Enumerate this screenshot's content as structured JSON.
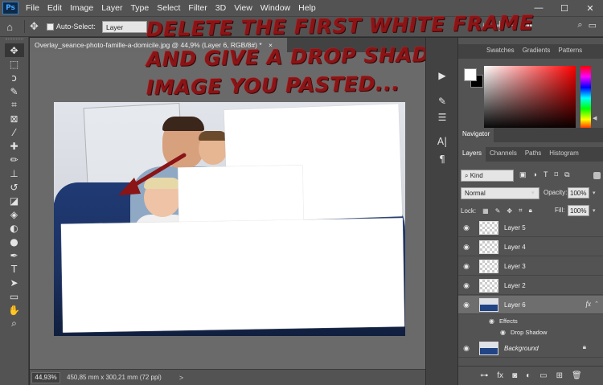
{
  "app": {
    "logo": "Ps"
  },
  "menu": [
    "File",
    "Edit",
    "Image",
    "Layer",
    "Type",
    "Select",
    "Filter",
    "3D",
    "View",
    "Window",
    "Help"
  ],
  "window_controls": {
    "minimize": "—",
    "maximize": "☐",
    "close": "✕"
  },
  "options_bar": {
    "auto_select_label": "Auto-Select:",
    "auto_select_value": "Layer",
    "more": "•••"
  },
  "document": {
    "tab_title": "Overlay_seance-photo-famille-a-domicile.jpg @ 44,9% (Layer 6, RGB/8#) *",
    "tab_close": "×"
  },
  "status": {
    "zoom": "44,93%",
    "doc_size": "450,85 mm x 300,21 mm (72 ppi)",
    "arrow": ">"
  },
  "instruction": {
    "line1": "DELETE THE FIRST WHITE FRAME",
    "line2": "AND GIVE A DROP SHADOW TO THE",
    "line3": "IMAGE YOU PASTED..."
  },
  "panels": {
    "color_tabs": [
      "Swatches",
      "Gradients",
      "Patterns"
    ],
    "navigator_tab": "Navigator",
    "layers_tabs": [
      "Layers",
      "Channels",
      "Paths",
      "Histogram"
    ],
    "kind_label": "Kind",
    "blend_mode": "Normal",
    "opacity_label": "Opacity:",
    "opacity_value": "100%",
    "lock_label": "Lock:",
    "fill_label": "Fill:",
    "fill_value": "100%"
  },
  "layers": [
    {
      "name": "Layer 5"
    },
    {
      "name": "Layer 4"
    },
    {
      "name": "Layer 3"
    },
    {
      "name": "Layer 2"
    },
    {
      "name": "Layer 6",
      "fx": "fx"
    },
    {
      "name": "Background"
    }
  ],
  "effects": {
    "group_label": "Effects",
    "drop_shadow_label": "Drop Shadow"
  },
  "colors": {
    "overlay_text": "#8a1416",
    "panel_bg": "#535353",
    "canvas_bg": "#6a6a6a"
  }
}
